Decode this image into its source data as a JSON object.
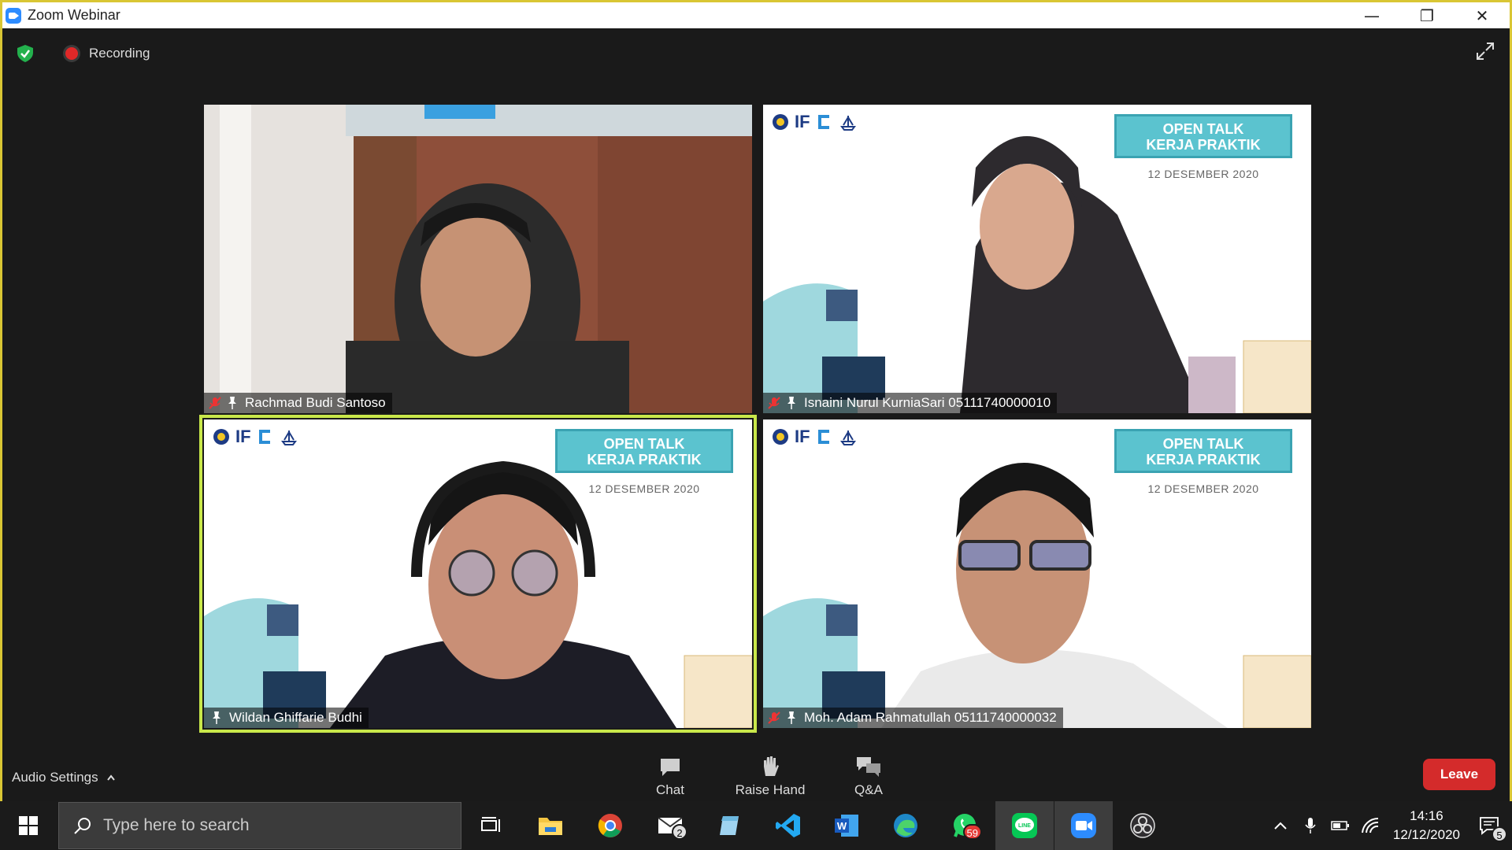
{
  "window": {
    "title": "Zoom Webinar"
  },
  "status": {
    "recording_label": "Recording"
  },
  "participants": [
    {
      "name": "Rachmad Budi Santoso",
      "muted": true
    },
    {
      "name": "Isnaini Nurul KurniaSari 05111740000010",
      "muted": true
    },
    {
      "name": "Wildan Ghiffarie Budhi",
      "muted": false
    },
    {
      "name": "Moh. Adam Rahmatullah 05111740000032",
      "muted": true
    }
  ],
  "banner": {
    "line1": "OPEN TALK",
    "line2": "KERJA PRAKTIK",
    "date": "12 DESEMBER 2020",
    "logo_text": "IF"
  },
  "controls": {
    "audio_settings": "Audio Settings",
    "chat": "Chat",
    "raise_hand": "Raise Hand",
    "qa": "Q&A",
    "leave": "Leave"
  },
  "taskbar": {
    "search_placeholder": "Type here to search",
    "mail_badge": "2",
    "whatsapp_badge": "59",
    "time": "14:16",
    "date": "12/12/2020",
    "notifications_badge": "5"
  },
  "colors": {
    "active_speaker": "#c9e84a",
    "leave": "#d42b2b",
    "window_border": "#d9c634",
    "banner": "#5bc3cf"
  }
}
